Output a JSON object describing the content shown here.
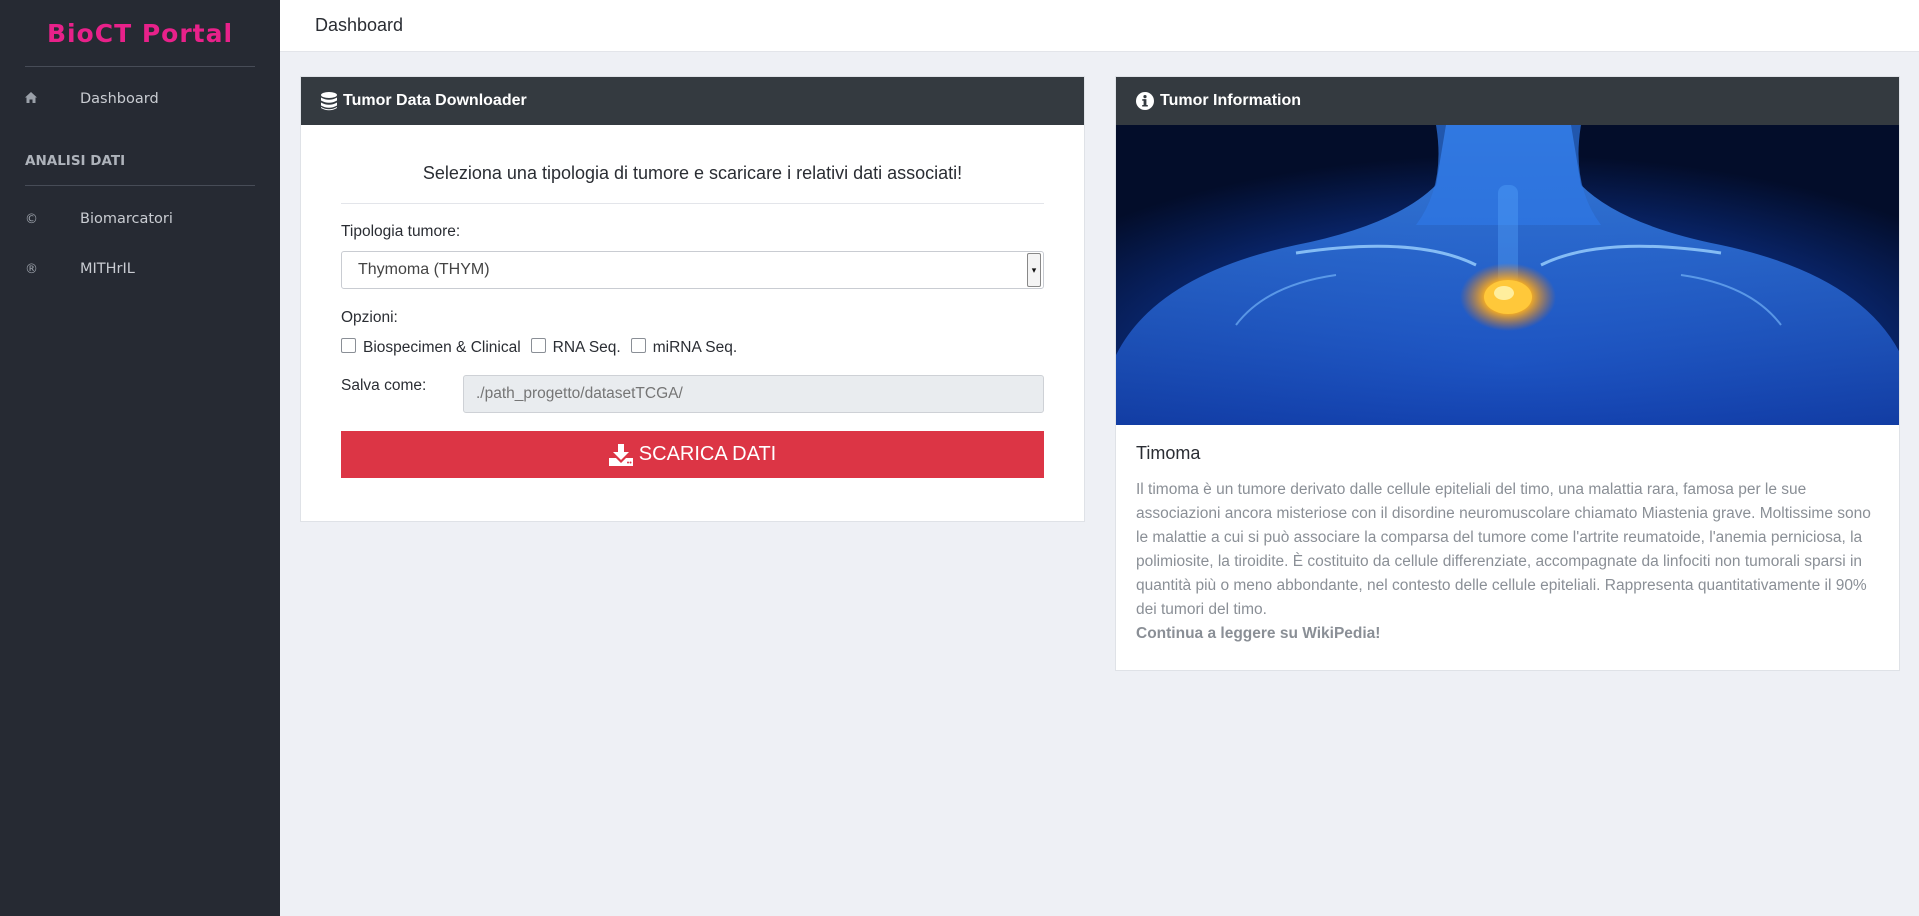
{
  "brand": {
    "name": "BioCT Portal"
  },
  "sidebar": {
    "items": [
      {
        "label": "Dashboard",
        "icon": "home-icon"
      }
    ],
    "section_heading": "ANALISI DATI",
    "section_items": [
      {
        "label": "Biomarcatori",
        "icon": "copyright-icon",
        "glyph": "©"
      },
      {
        "label": "MITHrIL",
        "icon": "registered-icon",
        "glyph": "®"
      }
    ]
  },
  "header": {
    "title": "Dashboard"
  },
  "downloader": {
    "title": "Tumor Data Downloader",
    "intro": "Seleziona una tipologia di tumore e scaricare i relativi dati associati!",
    "tumor_type_label": "Tipologia tumore:",
    "tumor_type_value": "Thymoma (THYM)",
    "options_label": "Opzioni:",
    "options": [
      {
        "label": "Biospecimen & Clinical",
        "checked": false
      },
      {
        "label": "RNA Seq.",
        "checked": false
      },
      {
        "label": "miRNA Seq.",
        "checked": false
      }
    ],
    "save_as_label": "Salva come:",
    "save_as_placeholder": "./path_progetto/datasetTCGA/",
    "button_label": "SCARICA DATI",
    "button_color": "#dc3545"
  },
  "tumor_info": {
    "title": "Tumor Information",
    "name": "Timoma",
    "description": "Il timoma è un tumore derivato dalle cellule epiteliali del timo, una malattia rara, famosa per le sue associazioni ancora misteriose con il disordine neuromuscolare chiamato Miastenia grave. Moltissime sono le malattie a cui si può associare la comparsa del tumore come l'artrite reumatoide, l'anemia perniciosa, la polimiosite, la tiroidite. È costituito da cellule differenziate, accompagnate da linfociti non tumorali sparsi in quantità più o meno abbondante, nel contesto delle cellule epiteliali. Rappresenta quantitativamente il 90% dei tumori del timo.",
    "link_text": "Continua a leggere su WikiPedia!"
  }
}
